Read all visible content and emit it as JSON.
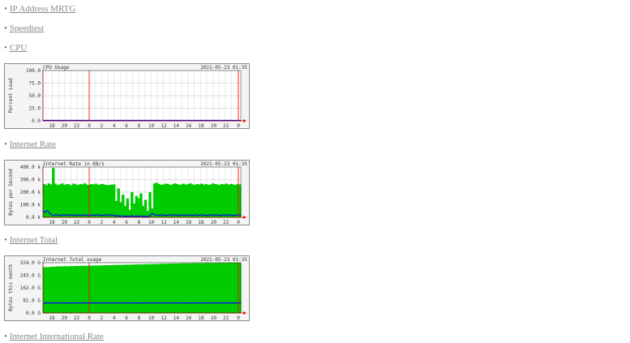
{
  "links": [
    {
      "bullet": "•",
      "label": "IP Address MRTG"
    },
    {
      "bullet": "•",
      "label": "Speedtest"
    },
    {
      "bullet": "•",
      "label": "CPU"
    },
    {
      "bullet": "•",
      "label": "Internet Rate"
    },
    {
      "bullet": "•",
      "label": "Internet Total"
    },
    {
      "bullet": "•",
      "label": "Internet International Rate"
    }
  ],
  "chart_data": [
    {
      "type": "area",
      "title": "CPU Usage",
      "timestamp": "2021-05-23 01:35",
      "ylabel": "Percent Load",
      "yticks": [
        "100.0",
        "75.0",
        "50.0",
        "25.0",
        "0.0"
      ],
      "ylim": [
        0,
        100
      ],
      "xticks": [
        "18",
        "20",
        "22",
        "0",
        "2",
        "4",
        "6",
        "8",
        "10",
        "12",
        "14",
        "16",
        "18",
        "20",
        "22",
        "0"
      ],
      "midnight_tick_indices": [
        3,
        15
      ],
      "grid": true,
      "series": [
        {
          "values": [
            0.8,
            0.8,
            0.8,
            0.8,
            0.8,
            0.8,
            0.8,
            0.8,
            0.8,
            0.8,
            0.8,
            0.8,
            0.8,
            0.8,
            0.8,
            0.8,
            0.8,
            0.8,
            0.8,
            0.8,
            0.8,
            0.8,
            0.8,
            0.8,
            0.8,
            0.8,
            0.8,
            0.8,
            0.8,
            0.8,
            0.8,
            0.8
          ],
          "color": "#0000ff",
          "style": "line"
        }
      ]
    },
    {
      "type": "area",
      "title": "Internet Rate in KB/s",
      "timestamp": "2021-05-23 01:35",
      "ylabel": "Bytes per Second",
      "yticks": [
        "400.0 k",
        "300.0 k",
        "200.0 k",
        "100.0 k",
        "0.0 k"
      ],
      "ylim": [
        0,
        400
      ],
      "xticks": [
        "18",
        "20",
        "22",
        "0",
        "2",
        "4",
        "6",
        "8",
        "10",
        "12",
        "14",
        "16",
        "18",
        "20",
        "22",
        "0"
      ],
      "midnight_tick_indices": [
        3,
        15
      ],
      "grid": true,
      "series": [
        {
          "values": [
            265,
            255,
            270,
            262,
            392,
            268,
            255,
            262,
            270,
            258,
            265,
            262,
            255,
            268,
            262,
            258,
            265,
            262,
            270,
            260,
            258,
            265,
            262,
            268,
            258,
            263,
            265,
            260,
            255,
            258,
            260,
            262,
            130,
            230,
            120,
            180,
            90,
            150,
            60,
            200,
            110,
            170,
            150,
            190,
            90,
            140,
            50,
            200,
            70,
            270,
            275,
            265,
            258,
            262,
            268,
            265,
            258,
            262,
            270,
            265,
            258,
            262,
            268,
            260,
            265,
            270,
            262,
            258,
            265,
            262,
            268,
            260,
            265,
            258,
            262,
            270,
            265,
            262,
            258,
            265,
            262,
            268,
            260,
            265,
            262,
            258,
            265,
            262
          ],
          "color": "#00cc00",
          "style": "area"
        },
        {
          "values": [
            50,
            40,
            55,
            30,
            18,
            16,
            20,
            18,
            15,
            20,
            18,
            16,
            20,
            18,
            15,
            20,
            18,
            16,
            20,
            18,
            15,
            20,
            18,
            16,
            20,
            18,
            15,
            20,
            18,
            16,
            20,
            18,
            10,
            14,
            8,
            12,
            6,
            10,
            5,
            12,
            8,
            10,
            9,
            11,
            6,
            9,
            4,
            12,
            30,
            20,
            18,
            16,
            20,
            18,
            15,
            20,
            18,
            16,
            20,
            18,
            15,
            20,
            18,
            16,
            20,
            18,
            15,
            20,
            18,
            16,
            20,
            18,
            15,
            20,
            18,
            16,
            20,
            18,
            15,
            20,
            18,
            16,
            20,
            18,
            15,
            20,
            18,
            16
          ],
          "color": "#0000ff",
          "style": "line"
        }
      ]
    },
    {
      "type": "area",
      "title": "Internet Total usage",
      "timestamp": "2021-05-23 01:35",
      "ylabel": "Bytes this month",
      "yticks": [
        "324.0 G",
        "243.0 G",
        "162.0 G",
        "81.0 G",
        "0.0 G"
      ],
      "ylim": [
        0,
        324
      ],
      "xticks": [
        "18",
        "20",
        "22",
        "0",
        "2",
        "4",
        "6",
        "8",
        "10",
        "12",
        "14",
        "16",
        "18",
        "20",
        "22",
        "0"
      ],
      "midnight_tick_indices": [
        3,
        15
      ],
      "grid": true,
      "series": [
        {
          "values": [
            296,
            298,
            300,
            301,
            302,
            303,
            304,
            305,
            306,
            307,
            308,
            309,
            310,
            311,
            312,
            313,
            314,
            315,
            316,
            317,
            318,
            319,
            320,
            320,
            321,
            321,
            322,
            322,
            323,
            323,
            324,
            324
          ],
          "color": "#00cc00",
          "style": "area"
        },
        {
          "values": [
            65,
            65,
            65,
            65,
            65,
            65,
            65,
            65,
            65,
            65,
            65,
            65,
            65,
            65,
            65,
            65,
            65,
            65,
            65,
            65,
            65,
            65,
            65,
            65,
            65,
            65,
            65,
            65,
            65,
            65,
            65,
            65
          ],
          "color": "#0000ff",
          "style": "line"
        }
      ]
    }
  ],
  "colors": {
    "grid": "#b0b0b0",
    "midnight": "#ff0000",
    "axis": "#ff0000",
    "plot_bg": "#ffffff",
    "frame_bg": "#f4f4f4"
  }
}
